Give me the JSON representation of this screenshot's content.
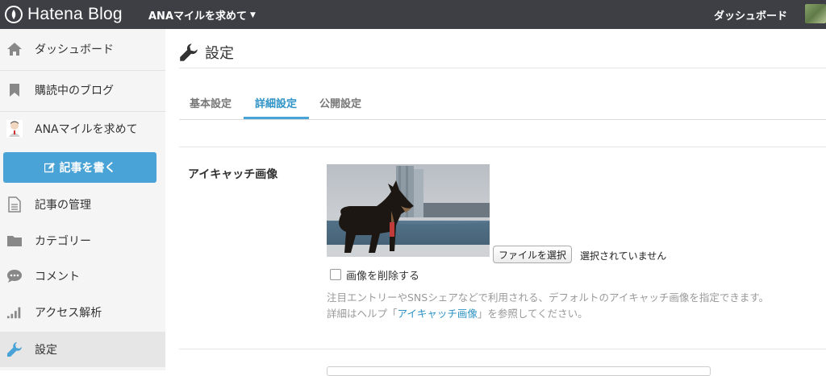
{
  "topbar": {
    "logo_text": "Hatena Blog",
    "blog_name": "ANAマイルを求めて",
    "dashboard_link": "ダッシュボード"
  },
  "sidebar": {
    "items": [
      {
        "label": "ダッシュボード",
        "icon": "home-icon"
      },
      {
        "label": "購読中のブログ",
        "icon": "bookmark-icon"
      },
      {
        "label": "ANAマイルを求めて",
        "icon": "blog-avatar"
      },
      {
        "label": "記事の管理",
        "icon": "document-icon"
      },
      {
        "label": "カテゴリー",
        "icon": "folder-icon"
      },
      {
        "label": "コメント",
        "icon": "comment-icon"
      },
      {
        "label": "アクセス解析",
        "icon": "bar-chart-icon"
      },
      {
        "label": "設定",
        "icon": "wrench-icon"
      }
    ],
    "write_button": "記事を書く"
  },
  "main": {
    "title": "設定",
    "tabs": [
      {
        "label": "基本設定",
        "active": false
      },
      {
        "label": "詳細設定",
        "active": true
      },
      {
        "label": "公開設定",
        "active": false
      }
    ],
    "eyecatch": {
      "label": "アイキャッチ画像",
      "file_button": "ファイルを選択",
      "file_status": "選択されていません",
      "delete_label": "画像を削除する",
      "delete_checked": false,
      "help_line1": "注目エントリーやSNSシェアなどで利用される、デフォルトのアイキャッチ画像を指定できます。",
      "help_line2_prefix": "詳細はヘルプ「",
      "help_link": "アイキャッチ画像",
      "help_line2_suffix": "」を参照してください。"
    }
  },
  "colors": {
    "topbar_bg": "#3d3f44",
    "accent": "#4aa3d6",
    "sidebar_bg": "#f5f5f5"
  }
}
